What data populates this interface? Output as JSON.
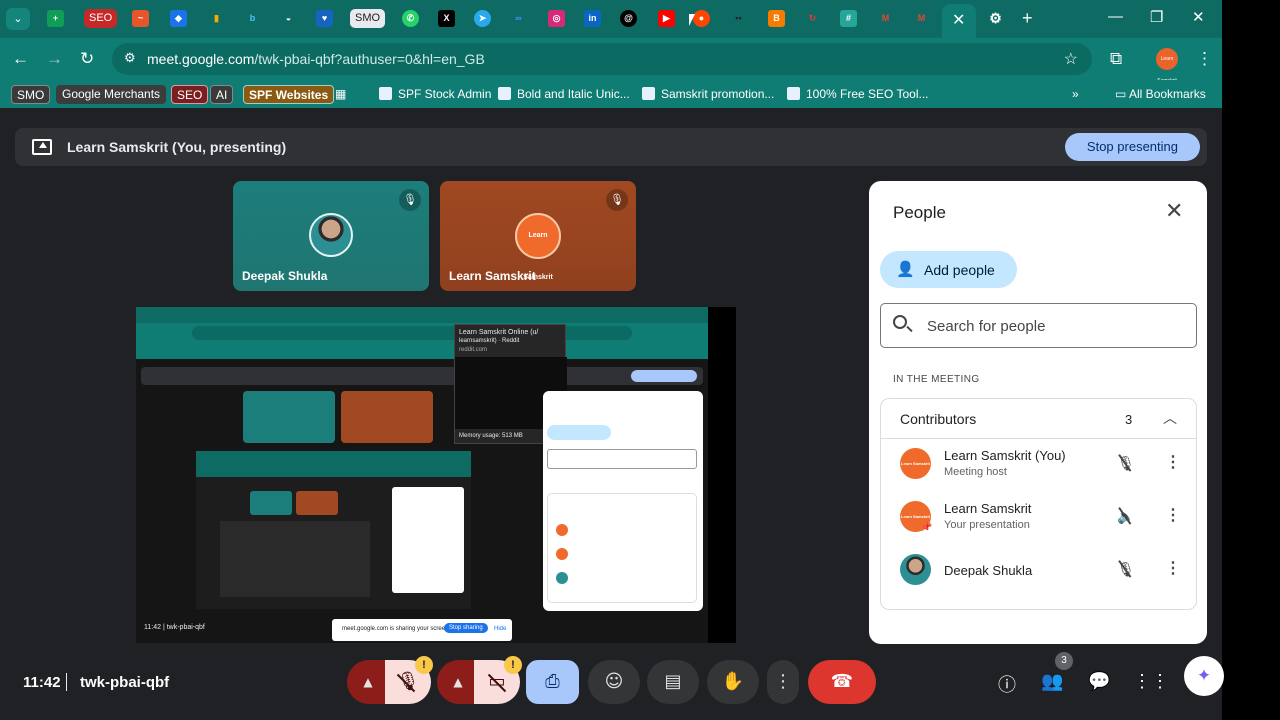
{
  "browser": {
    "tab_pills": {
      "smo": "SMO",
      "seo": "SEO"
    },
    "url_host": "meet.google.com",
    "url_path": "/twk-pbai-qbf?authuser=0&hl=en_GB",
    "bookmarks": [
      {
        "label": "SMO"
      },
      {
        "label": "Google Merchants"
      },
      {
        "label": "SEO"
      },
      {
        "label": "AI"
      },
      {
        "label": "SPF Websites"
      },
      {
        "label": "SPF Stock Admin"
      },
      {
        "label": "Bold and Italic Unic..."
      },
      {
        "label": "Samskrit promotion..."
      },
      {
        "label": "100% Free SEO Tool..."
      }
    ],
    "all_bookmarks": "All Bookmarks",
    "profile_text": "Learn Samskrit"
  },
  "meet": {
    "presenting_title": "Learn Samskrit (You, presenting)",
    "stop_presenting": "Stop presenting",
    "tiles": [
      {
        "name": "Deepak Shukla"
      },
      {
        "name": "Learn Samskrit",
        "logo_text": "Learn Samskrit"
      }
    ],
    "shared_screen": {
      "popup_title": "Learn Samskrit Online (u/",
      "popup_sub": "learnsamskrit) · Reddit",
      "popup_site": "reddit.com",
      "memory": "Memory usage: 513 MB",
      "share_notice": "meet.google.com is sharing your screen.",
      "stop_sharing": "Stop sharing",
      "hide": "Hide",
      "time": "11:42",
      "code": "twk-pbai-qbf"
    }
  },
  "people": {
    "title": "People",
    "add_people": "Add people",
    "search_placeholder": "Search for people",
    "section": "IN THE MEETING",
    "group_title": "Contributors",
    "group_count": "3",
    "participants": [
      {
        "name": "Learn Samskrit (You)",
        "role": "Meeting host",
        "avatar_text": "Learn Samskrit"
      },
      {
        "name": "Learn Samskrit",
        "role": "Your presentation",
        "avatar_text": "Learn Samskrit"
      },
      {
        "name": "Deepak Shukla",
        "role": ""
      }
    ]
  },
  "bottom": {
    "time": "11:42",
    "separator": "|",
    "meeting_code": "twk-pbai-qbf",
    "warning": "!",
    "people_badge": "3"
  },
  "colors": {
    "chrome_teal": "#0f7d74",
    "accent_blue": "#a8c7fa",
    "end_call_red": "#dc362e",
    "panel_bg": "#ffffff"
  },
  "icons": {
    "tabstrip": [
      "tab-search-icon",
      "sheets-icon",
      "seo-tab-icon",
      "brand-icon",
      "bing-icon",
      "analytics-icon",
      "bing-b-icon",
      "incognito-icon",
      "shield-icon",
      "smo-tab-icon",
      "whatsapp-icon",
      "x-icon",
      "telegram-icon",
      "meta-icon",
      "instagram-icon",
      "linkedin-icon",
      "threads-icon",
      "youtube-icon",
      "reddit-icon",
      "grid-icon",
      "blogger-icon",
      "pinterest-icon",
      "hashtag-icon",
      "gmail-icon",
      "gmail-icon",
      "close-icon",
      "settings-icon",
      "plus-icon"
    ]
  }
}
